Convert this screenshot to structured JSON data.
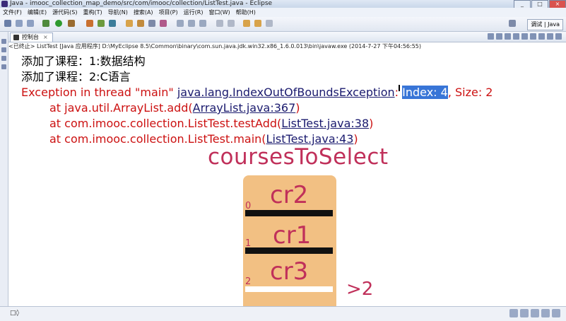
{
  "window": {
    "title": "Java - imooc_collection_map_demo/src/com/imooc/collection/ListTest.java - Eclipse"
  },
  "menu": [
    "文件(F)",
    "编辑(E)",
    "源代码(S)",
    "重构(T)",
    "导航(N)",
    "搜索(A)",
    "项目(P)",
    "运行(R)",
    "窗口(W)",
    "帮助(H)"
  ],
  "perspective": {
    "label": "Java",
    "debug_label": "调试"
  },
  "console_view": {
    "tab_label": "控制台",
    "status": "<已终止> ListTest [Java 应用程序] D:\\MyEclipse 8.5\\Common\\binary\\com.sun.java.jdk.win32.x86_1.6.0.013\\bin\\javaw.exe (2014-7-27 下午04:56:55)",
    "out1": "添加了课程：1:数据结构",
    "out2": "添加了课程：2:C语言",
    "exc_prefix": "Exception in thread \"main\" ",
    "exc_class": "java.lang.IndexOutOfBoundsException",
    "exc_colon": ":",
    "exc_index": "Index: 4",
    "exc_size": ", Size: 2",
    "frames": [
      {
        "pre": "at java.util.ArrayList.add(",
        "link": "ArrayList.java:367",
        "post": ")"
      },
      {
        "pre": "at com.imooc.collection.ListTest.testAdd(",
        "link": "ListTest.java:38",
        "post": ")"
      },
      {
        "pre": "at com.imooc.collection.ListTest.main(",
        "link": "ListTest.java:43",
        "post": ")"
      }
    ]
  },
  "drawing": {
    "title": "coursesToSelect",
    "items": [
      "cr2",
      "cr1",
      "cr3"
    ],
    "indices": [
      "0",
      "1",
      "2"
    ],
    "note": ">2"
  }
}
